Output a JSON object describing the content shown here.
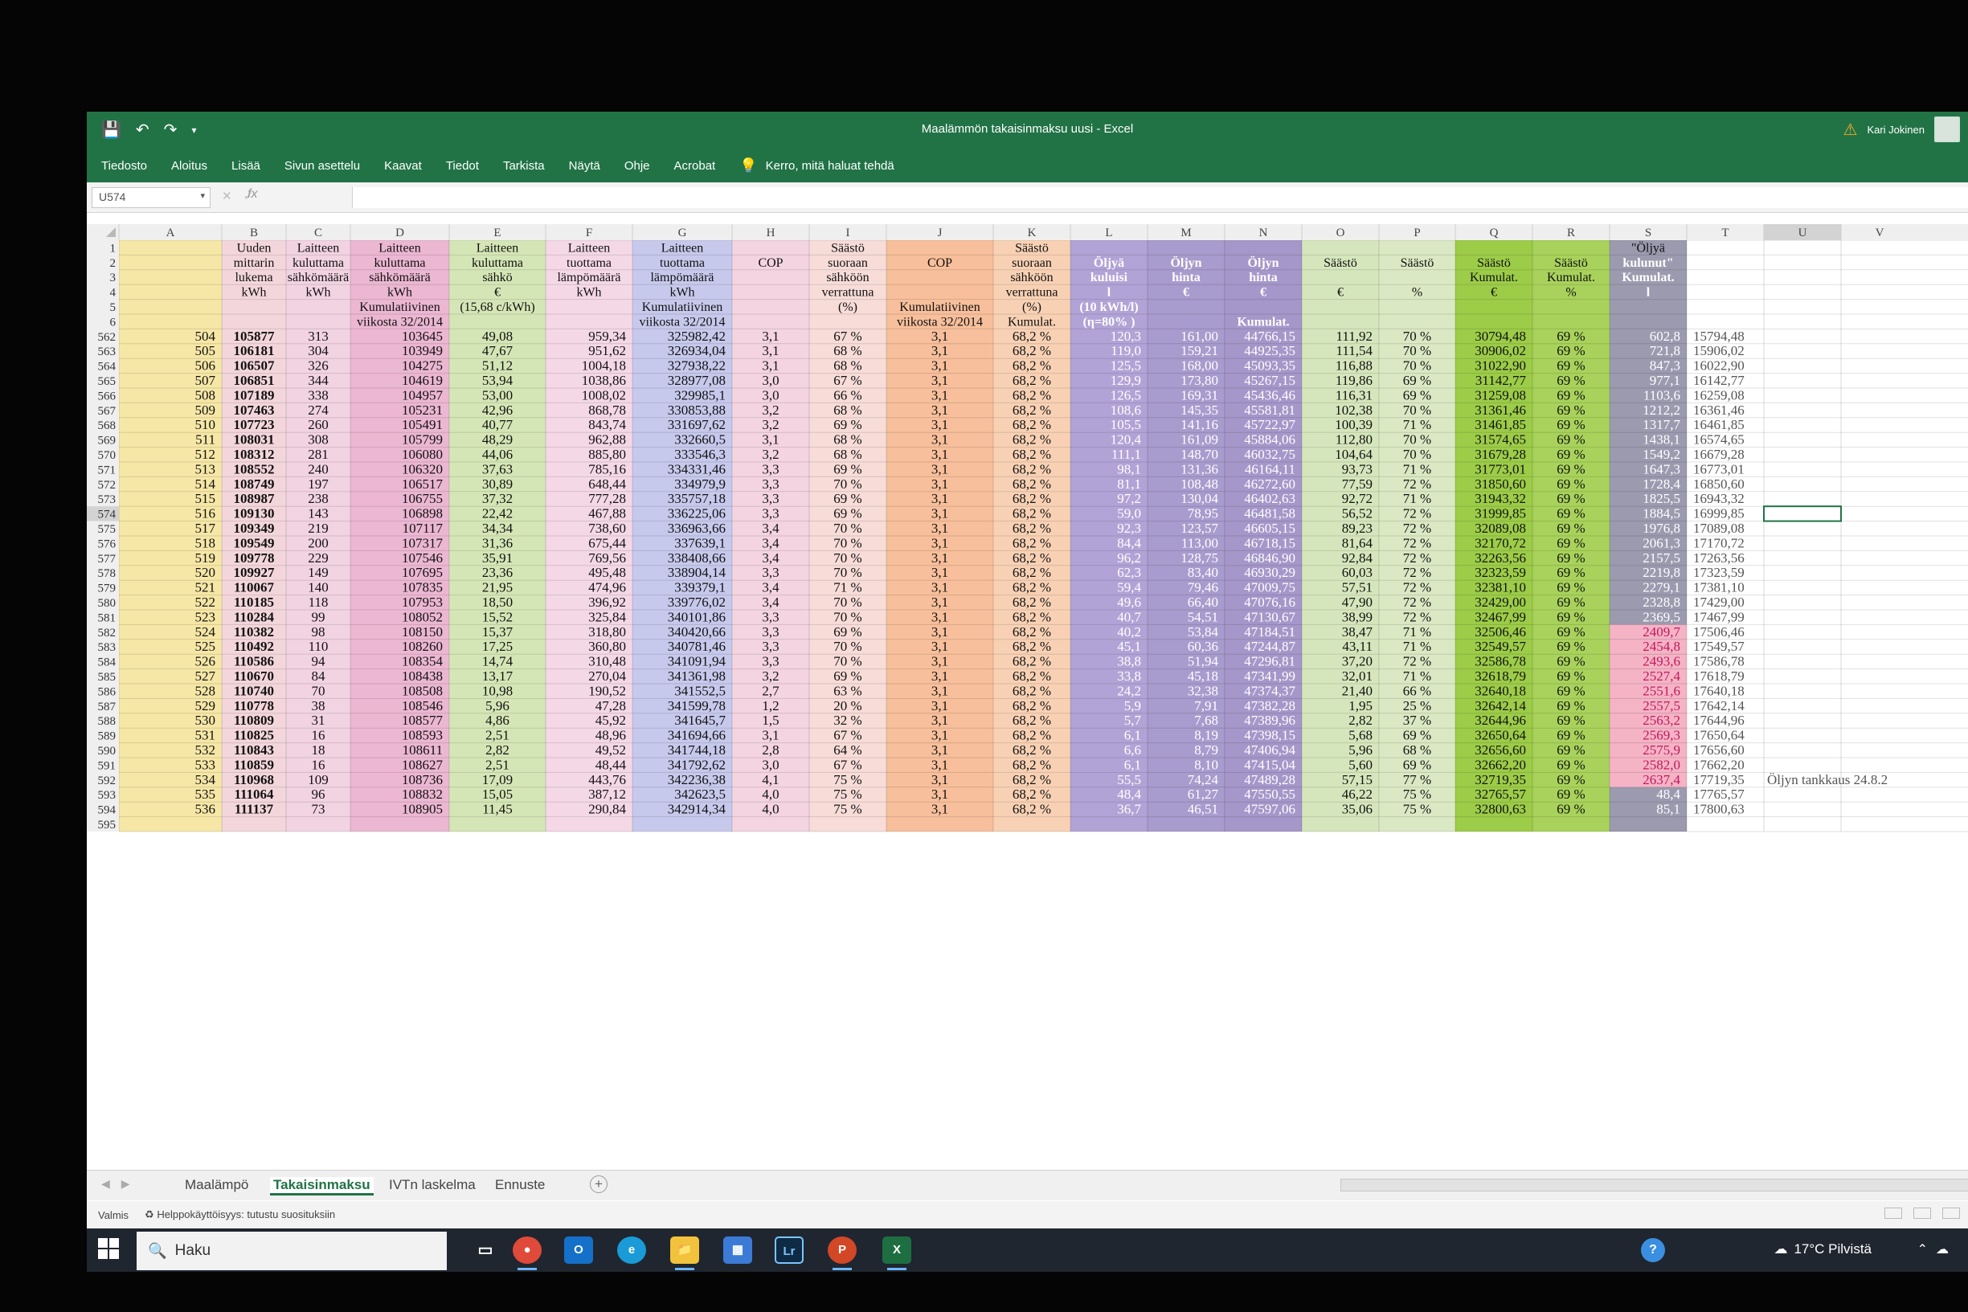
{
  "window": {
    "title": "Maalämmön takaisinmaksu uusi - Excel",
    "user": "Kari Jokinen"
  },
  "qat": {
    "save_icon": "save-icon",
    "undo_icon": "undo-icon",
    "redo_icon": "redo-icon"
  },
  "ribbon": {
    "tabs": [
      "Tiedosto",
      "Aloitus",
      "Lisää",
      "Sivun asettelu",
      "Kaavat",
      "Tiedot",
      "Tarkista",
      "Näytä",
      "Ohje",
      "Acrobat"
    ],
    "tell_me": "Kerro, mitä haluat tehdä"
  },
  "formula_bar": {
    "name_box": "U574",
    "fx": "fx",
    "formula": ""
  },
  "columns": [
    "A",
    "B",
    "C",
    "D",
    "E",
    "F",
    "G",
    "H",
    "I",
    "J",
    "K",
    "L",
    "M",
    "N",
    "O",
    "P",
    "Q",
    "R",
    "S",
    "T",
    "U",
    "V"
  ],
  "column_colors": {
    "A": "#f6e7a6",
    "B": "#f3d6dc",
    "C": "#f2d3e2",
    "D": "#ebb7d2",
    "E": "#d5e6b6",
    "F": "#f4d8e6",
    "G": "#c7c9ec",
    "H": "#f4d4e1",
    "I": "#f7dcd8",
    "J": "#f7bf9b",
    "K": "#f8d1b4",
    "L": "#b2a3d6",
    "M": "#a89bcd",
    "N": "#a597c9",
    "O": "#d6e6bc",
    "P": "#dae8c3",
    "Q": "#9ccc48",
    "R": "#a8d25b",
    "S": "#9c9aaf",
    "T": "#ffffff",
    "U": "#ffffff",
    "V": "#ffffff"
  },
  "header_rows": [
    {
      "row": "1",
      "B": "Uuden",
      "C": "Laitteen",
      "D": "Laitteen",
      "E": "Laitteen",
      "F": "Laitteen",
      "G": "Laitteen",
      "I": "Säästö",
      "K": "Säästö",
      "S": "\"Öljyä"
    },
    {
      "row": "2",
      "B": "mittarin",
      "C": "kuluttama",
      "D": "kuluttama",
      "E": "kuluttama",
      "F": "tuottama",
      "G": "tuottama",
      "H": "COP",
      "I": "suoraan",
      "J": "COP",
      "K": "suoraan",
      "L": "Öljyä",
      "M": "Öljyn",
      "N": "Öljyn",
      "O": "Säästö",
      "P": "Säästö",
      "Q": "Säästö",
      "R": "Säästö",
      "S": "kulunut\""
    },
    {
      "row": "3",
      "B": "lukema",
      "C": "sähkömäärä",
      "D": "sähkömäärä",
      "E": "sähkö",
      "F": "lämpömäärä",
      "G": "lämpömäärä",
      "I": "sähköön",
      "K": "sähköön",
      "L": "kuluisi",
      "M": "hinta",
      "N": "hinta",
      "Q": "Kumulat.",
      "R": "Kumulat.",
      "S": "Kumulat."
    },
    {
      "row": "4",
      "B": "kWh",
      "C": "kWh",
      "D": "kWh",
      "E": "€",
      "F": "kWh",
      "G": "kWh",
      "I": "verrattuna",
      "K": "verrattuna",
      "L": "l",
      "M": "€",
      "N": "€",
      "O": "€",
      "P": "%",
      "Q": "€",
      "R": "%",
      "S": "l"
    },
    {
      "row": "5",
      "D": "Kumulatiivinen",
      "E": "(15,68 c/kWh)",
      "G": "Kumulatiivinen",
      "I": "(%)",
      "J": "Kumulatiivinen",
      "K": "(%)",
      "L": "(10 kWh/l)"
    },
    {
      "row": "6",
      "D": "viikosta 32/2014",
      "G": "viikosta 32/2014",
      "J": "viikosta 32/2014",
      "K": "Kumulat.",
      "L": "(η=80% )",
      "N": "Kumulat."
    }
  ],
  "data_rows": [
    [
      "562",
      "504",
      "105877",
      "313",
      "103645",
      "49,08",
      "959,34",
      "325982,42",
      "3,1",
      "67 %",
      "3,1",
      "68,2 %",
      "120,3",
      "161,00",
      "44766,15",
      "111,92",
      "70 %",
      "30794,48",
      "69 %",
      "602,8",
      "15794,48"
    ],
    [
      "563",
      "505",
      "106181",
      "304",
      "103949",
      "47,67",
      "951,62",
      "326934,04",
      "3,1",
      "68 %",
      "3,1",
      "68,2 %",
      "119,0",
      "159,21",
      "44925,35",
      "111,54",
      "70 %",
      "30906,02",
      "69 %",
      "721,8",
      "15906,02"
    ],
    [
      "564",
      "506",
      "106507",
      "326",
      "104275",
      "51,12",
      "1004,18",
      "327938,22",
      "3,1",
      "68 %",
      "3,1",
      "68,2 %",
      "125,5",
      "168,00",
      "45093,35",
      "116,88",
      "70 %",
      "31022,90",
      "69 %",
      "847,3",
      "16022,90"
    ],
    [
      "565",
      "507",
      "106851",
      "344",
      "104619",
      "53,94",
      "1038,86",
      "328977,08",
      "3,0",
      "67 %",
      "3,1",
      "68,2 %",
      "129,9",
      "173,80",
      "45267,15",
      "119,86",
      "69 %",
      "31142,77",
      "69 %",
      "977,1",
      "16142,77"
    ],
    [
      "566",
      "508",
      "107189",
      "338",
      "104957",
      "53,00",
      "1008,02",
      "329985,1",
      "3,0",
      "66 %",
      "3,1",
      "68,2 %",
      "126,5",
      "169,31",
      "45436,46",
      "116,31",
      "69 %",
      "31259,08",
      "69 %",
      "1103,6",
      "16259,08"
    ],
    [
      "567",
      "509",
      "107463",
      "274",
      "105231",
      "42,96",
      "868,78",
      "330853,88",
      "3,2",
      "68 %",
      "3,1",
      "68,2 %",
      "108,6",
      "145,35",
      "45581,81",
      "102,38",
      "70 %",
      "31361,46",
      "69 %",
      "1212,2",
      "16361,46"
    ],
    [
      "568",
      "510",
      "107723",
      "260",
      "105491",
      "40,77",
      "843,74",
      "331697,62",
      "3,2",
      "69 %",
      "3,1",
      "68,2 %",
      "105,5",
      "141,16",
      "45722,97",
      "100,39",
      "71 %",
      "31461,85",
      "69 %",
      "1317,7",
      "16461,85"
    ],
    [
      "569",
      "511",
      "108031",
      "308",
      "105799",
      "48,29",
      "962,88",
      "332660,5",
      "3,1",
      "68 %",
      "3,1",
      "68,2 %",
      "120,4",
      "161,09",
      "45884,06",
      "112,80",
      "70 %",
      "31574,65",
      "69 %",
      "1438,1",
      "16574,65"
    ],
    [
      "570",
      "512",
      "108312",
      "281",
      "106080",
      "44,06",
      "885,80",
      "333546,3",
      "3,2",
      "68 %",
      "3,1",
      "68,2 %",
      "111,1",
      "148,70",
      "46032,75",
      "104,64",
      "70 %",
      "31679,28",
      "69 %",
      "1549,2",
      "16679,28"
    ],
    [
      "571",
      "513",
      "108552",
      "240",
      "106320",
      "37,63",
      "785,16",
      "334331,46",
      "3,3",
      "69 %",
      "3,1",
      "68,2 %",
      "98,1",
      "131,36",
      "46164,11",
      "93,73",
      "71 %",
      "31773,01",
      "69 %",
      "1647,3",
      "16773,01"
    ],
    [
      "572",
      "514",
      "108749",
      "197",
      "106517",
      "30,89",
      "648,44",
      "334979,9",
      "3,3",
      "70 %",
      "3,1",
      "68,2 %",
      "81,1",
      "108,48",
      "46272,60",
      "77,59",
      "72 %",
      "31850,60",
      "69 %",
      "1728,4",
      "16850,60"
    ],
    [
      "573",
      "515",
      "108987",
      "238",
      "106755",
      "37,32",
      "777,28",
      "335757,18",
      "3,3",
      "69 %",
      "3,1",
      "68,2 %",
      "97,2",
      "130,04",
      "46402,63",
      "92,72",
      "71 %",
      "31943,32",
      "69 %",
      "1825,5",
      "16943,32"
    ],
    [
      "574",
      "516",
      "109130",
      "143",
      "106898",
      "22,42",
      "467,88",
      "336225,06",
      "3,3",
      "69 %",
      "3,1",
      "68,2 %",
      "59,0",
      "78,95",
      "46481,58",
      "56,52",
      "72 %",
      "31999,85",
      "69 %",
      "1884,5",
      "16999,85"
    ],
    [
      "575",
      "517",
      "109349",
      "219",
      "107117",
      "34,34",
      "738,60",
      "336963,66",
      "3,4",
      "70 %",
      "3,1",
      "68,2 %",
      "92,3",
      "123,57",
      "46605,15",
      "89,23",
      "72 %",
      "32089,08",
      "69 %",
      "1976,8",
      "17089,08"
    ],
    [
      "576",
      "518",
      "109549",
      "200",
      "107317",
      "31,36",
      "675,44",
      "337639,1",
      "3,4",
      "70 %",
      "3,1",
      "68,2 %",
      "84,4",
      "113,00",
      "46718,15",
      "81,64",
      "72 %",
      "32170,72",
      "69 %",
      "2061,3",
      "17170,72"
    ],
    [
      "577",
      "519",
      "109778",
      "229",
      "107546",
      "35,91",
      "769,56",
      "338408,66",
      "3,4",
      "70 %",
      "3,1",
      "68,2 %",
      "96,2",
      "128,75",
      "46846,90",
      "92,84",
      "72 %",
      "32263,56",
      "69 %",
      "2157,5",
      "17263,56"
    ],
    [
      "578",
      "520",
      "109927",
      "149",
      "107695",
      "23,36",
      "495,48",
      "338904,14",
      "3,3",
      "70 %",
      "3,1",
      "68,2 %",
      "62,3",
      "83,40",
      "46930,29",
      "60,03",
      "72 %",
      "32323,59",
      "69 %",
      "2219,8",
      "17323,59"
    ],
    [
      "579",
      "521",
      "110067",
      "140",
      "107835",
      "21,95",
      "474,96",
      "339379,1",
      "3,4",
      "71 %",
      "3,1",
      "68,2 %",
      "59,4",
      "79,46",
      "47009,75",
      "57,51",
      "72 %",
      "32381,10",
      "69 %",
      "2279,1",
      "17381,10"
    ],
    [
      "580",
      "522",
      "110185",
      "118",
      "107953",
      "18,50",
      "396,92",
      "339776,02",
      "3,4",
      "70 %",
      "3,1",
      "68,2 %",
      "49,6",
      "66,40",
      "47076,16",
      "47,90",
      "72 %",
      "32429,00",
      "69 %",
      "2328,8",
      "17429,00"
    ],
    [
      "581",
      "523",
      "110284",
      "99",
      "108052",
      "15,52",
      "325,84",
      "340101,86",
      "3,3",
      "70 %",
      "3,1",
      "68,2 %",
      "40,7",
      "54,51",
      "47130,67",
      "38,99",
      "72 %",
      "32467,99",
      "69 %",
      "2369,5",
      "17467,99"
    ],
    [
      "582",
      "524",
      "110382",
      "98",
      "108150",
      "15,37",
      "318,80",
      "340420,66",
      "3,3",
      "69 %",
      "3,1",
      "68,2 %",
      "40,2",
      "53,84",
      "47184,51",
      "38,47",
      "71 %",
      "32506,46",
      "69 %",
      "2409,7",
      "17506,46"
    ],
    [
      "583",
      "525",
      "110492",
      "110",
      "108260",
      "17,25",
      "360,80",
      "340781,46",
      "3,3",
      "70 %",
      "3,1",
      "68,2 %",
      "45,1",
      "60,36",
      "47244,87",
      "43,11",
      "71 %",
      "32549,57",
      "69 %",
      "2454,8",
      "17549,57"
    ],
    [
      "584",
      "526",
      "110586",
      "94",
      "108354",
      "14,74",
      "310,48",
      "341091,94",
      "3,3",
      "70 %",
      "3,1",
      "68,2 %",
      "38,8",
      "51,94",
      "47296,81",
      "37,20",
      "72 %",
      "32586,78",
      "69 %",
      "2493,6",
      "17586,78"
    ],
    [
      "585",
      "527",
      "110670",
      "84",
      "108438",
      "13,17",
      "270,04",
      "341361,98",
      "3,2",
      "69 %",
      "3,1",
      "68,2 %",
      "33,8",
      "45,18",
      "47341,99",
      "32,01",
      "71 %",
      "32618,79",
      "69 %",
      "2527,4",
      "17618,79"
    ],
    [
      "586",
      "528",
      "110740",
      "70",
      "108508",
      "10,98",
      "190,52",
      "341552,5",
      "2,7",
      "63 %",
      "3,1",
      "68,2 %",
      "24,2",
      "32,38",
      "47374,37",
      "21,40",
      "66 %",
      "32640,18",
      "69 %",
      "2551,6",
      "17640,18"
    ],
    [
      "587",
      "529",
      "110778",
      "38",
      "108546",
      "5,96",
      "47,28",
      "341599,78",
      "1,2",
      "20 %",
      "3,1",
      "68,2 %",
      "5,9",
      "7,91",
      "47382,28",
      "1,95",
      "25 %",
      "32642,14",
      "69 %",
      "2557,5",
      "17642,14"
    ],
    [
      "588",
      "530",
      "110809",
      "31",
      "108577",
      "4,86",
      "45,92",
      "341645,7",
      "1,5",
      "32 %",
      "3,1",
      "68,2 %",
      "5,7",
      "7,68",
      "47389,96",
      "2,82",
      "37 %",
      "32644,96",
      "69 %",
      "2563,2",
      "17644,96"
    ],
    [
      "589",
      "531",
      "110825",
      "16",
      "108593",
      "2,51",
      "48,96",
      "341694,66",
      "3,1",
      "67 %",
      "3,1",
      "68,2 %",
      "6,1",
      "8,19",
      "47398,15",
      "5,68",
      "69 %",
      "32650,64",
      "69 %",
      "2569,3",
      "17650,64"
    ],
    [
      "590",
      "532",
      "110843",
      "18",
      "108611",
      "2,82",
      "49,52",
      "341744,18",
      "2,8",
      "64 %",
      "3,1",
      "68,2 %",
      "6,6",
      "8,79",
      "47406,94",
      "5,96",
      "68 %",
      "32656,60",
      "69 %",
      "2575,9",
      "17656,60"
    ],
    [
      "591",
      "533",
      "110859",
      "16",
      "108627",
      "2,51",
      "48,44",
      "341792,62",
      "3,0",
      "67 %",
      "3,1",
      "68,2 %",
      "6,1",
      "8,10",
      "47415,04",
      "5,60",
      "69 %",
      "32662,20",
      "69 %",
      "2582,0",
      "17662,20"
    ],
    [
      "592",
      "534",
      "110968",
      "109",
      "108736",
      "17,09",
      "443,76",
      "342236,38",
      "4,1",
      "75 %",
      "3,1",
      "68,2 %",
      "55,5",
      "74,24",
      "47489,28",
      "57,15",
      "77 %",
      "32719,35",
      "69 %",
      "2637,4",
      "17719,35"
    ],
    [
      "593",
      "535",
      "111064",
      "96",
      "108832",
      "15,05",
      "387,12",
      "342623,5",
      "4,0",
      "75 %",
      "3,1",
      "68,2 %",
      "48,4",
      "61,27",
      "47550,55",
      "46,22",
      "75 %",
      "32765,57",
      "69 %",
      "48,4",
      "17765,57"
    ],
    [
      "594",
      "536",
      "111137",
      "73",
      "108905",
      "11,45",
      "290,84",
      "342914,34",
      "4,0",
      "75 %",
      "3,1",
      "68,2 %",
      "36,7",
      "46,51",
      "47597,06",
      "35,06",
      "75 %",
      "32800,63",
      "69 %",
      "85,1",
      "17800,63"
    ]
  ],
  "pink_s_rows": [
    "582",
    "583",
    "584",
    "585",
    "586",
    "587",
    "588",
    "589",
    "590",
    "591",
    "592"
  ],
  "row_595": "595",
  "note_592": "Öljyn tankkaus 24.8.2",
  "selected_cell": "U574",
  "sheets": [
    "Maalämpö",
    "Takaisinmaksu",
    "IVTn laskelma",
    "Ennuste"
  ],
  "active_sheet": "Takaisinmaksu",
  "status": {
    "ready": "Valmis",
    "accessibility": "Helppokäyttöisyys: tutustu suosituksiin"
  },
  "taskbar": {
    "search_placeholder": "Haku",
    "apps": [
      "task-view",
      "chrome",
      "outlook",
      "edge",
      "file-explorer",
      "microsoft-store",
      "lightroom",
      "powerpoint",
      "excel"
    ],
    "lightroom_label": "Lr",
    "weather": "17°C Pilvistä"
  }
}
